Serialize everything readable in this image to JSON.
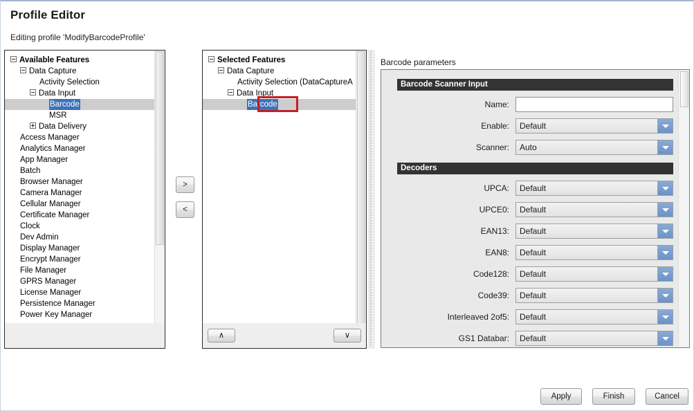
{
  "window": {
    "title": "Profile Editor",
    "subtitle": "Editing profile 'ModifyBarcodeProfile'"
  },
  "available_panel": {
    "title": "Available Features",
    "items": [
      {
        "label": "Available Features",
        "indent": 0,
        "toggle": "minus",
        "bold": true,
        "selected": false
      },
      {
        "label": "Data Capture",
        "indent": 1,
        "toggle": "minus",
        "bold": false,
        "selected": false
      },
      {
        "label": "Activity Selection",
        "indent": 3,
        "toggle": "none",
        "bold": false,
        "selected": false
      },
      {
        "label": "Data Input",
        "indent": 2,
        "toggle": "minus",
        "bold": false,
        "selected": false
      },
      {
        "label": "Barcode",
        "indent": 4,
        "toggle": "none",
        "bold": false,
        "selected": true
      },
      {
        "label": "MSR",
        "indent": 4,
        "toggle": "none",
        "bold": false,
        "selected": false
      },
      {
        "label": "Data Delivery",
        "indent": 2,
        "toggle": "plus",
        "bold": false,
        "selected": false
      },
      {
        "label": "Access Manager",
        "indent": 1,
        "toggle": "none",
        "bold": false,
        "selected": false
      },
      {
        "label": "Analytics Manager",
        "indent": 1,
        "toggle": "none",
        "bold": false,
        "selected": false
      },
      {
        "label": "App Manager",
        "indent": 1,
        "toggle": "none",
        "bold": false,
        "selected": false
      },
      {
        "label": "Batch",
        "indent": 1,
        "toggle": "none",
        "bold": false,
        "selected": false
      },
      {
        "label": "Browser Manager",
        "indent": 1,
        "toggle": "none",
        "bold": false,
        "selected": false
      },
      {
        "label": "Camera Manager",
        "indent": 1,
        "toggle": "none",
        "bold": false,
        "selected": false
      },
      {
        "label": "Cellular Manager",
        "indent": 1,
        "toggle": "none",
        "bold": false,
        "selected": false
      },
      {
        "label": "Certificate Manager",
        "indent": 1,
        "toggle": "none",
        "bold": false,
        "selected": false
      },
      {
        "label": "Clock",
        "indent": 1,
        "toggle": "none",
        "bold": false,
        "selected": false
      },
      {
        "label": "Dev Admin",
        "indent": 1,
        "toggle": "none",
        "bold": false,
        "selected": false
      },
      {
        "label": "Display Manager",
        "indent": 1,
        "toggle": "none",
        "bold": false,
        "selected": false
      },
      {
        "label": "Encrypt Manager",
        "indent": 1,
        "toggle": "none",
        "bold": false,
        "selected": false
      },
      {
        "label": "File Manager",
        "indent": 1,
        "toggle": "none",
        "bold": false,
        "selected": false
      },
      {
        "label": "GPRS Manager",
        "indent": 1,
        "toggle": "none",
        "bold": false,
        "selected": false
      },
      {
        "label": "License Manager",
        "indent": 1,
        "toggle": "none",
        "bold": false,
        "selected": false
      },
      {
        "label": "Persistence Manager",
        "indent": 1,
        "toggle": "none",
        "bold": false,
        "selected": false
      },
      {
        "label": "Power Key Manager",
        "indent": 1,
        "toggle": "none",
        "bold": false,
        "selected": false
      }
    ]
  },
  "selected_panel": {
    "title": "Selected Features",
    "items": [
      {
        "label": "Selected Features",
        "indent": 0,
        "toggle": "minus",
        "bold": true,
        "selected": false
      },
      {
        "label": "Data Capture",
        "indent": 1,
        "toggle": "minus",
        "bold": false,
        "selected": false
      },
      {
        "label": "Activity Selection (DataCaptureA",
        "indent": 3,
        "toggle": "none",
        "bold": false,
        "selected": false
      },
      {
        "label": "Data Input",
        "indent": 2,
        "toggle": "minus",
        "bold": false,
        "selected": false
      },
      {
        "label": "Barcode",
        "indent": 4,
        "toggle": "none",
        "bold": false,
        "selected": true
      }
    ]
  },
  "transfer_buttons": {
    "add_label": ">",
    "remove_label": "<"
  },
  "order_buttons": {
    "up_label": "∧",
    "down_label": "∨"
  },
  "params": {
    "caption": "Barcode parameters",
    "sections": [
      {
        "heading": "Barcode Scanner Input",
        "fields": [
          {
            "label": "Name:",
            "type": "text",
            "value": "",
            "placeholder": ""
          },
          {
            "label": "Enable:",
            "type": "combo",
            "value": "Default"
          },
          {
            "label": "Scanner:",
            "type": "combo",
            "value": "Auto"
          }
        ]
      },
      {
        "heading": "Decoders",
        "fields": [
          {
            "label": "UPCA:",
            "type": "combo",
            "value": "Default"
          },
          {
            "label": "UPCE0:",
            "type": "combo",
            "value": "Default"
          },
          {
            "label": "EAN13:",
            "type": "combo",
            "value": "Default"
          },
          {
            "label": "EAN8:",
            "type": "combo",
            "value": "Default"
          },
          {
            "label": "Code128:",
            "type": "combo",
            "value": "Default"
          },
          {
            "label": "Code39:",
            "type": "combo",
            "value": "Default"
          },
          {
            "label": "Interleaved 2of5:",
            "type": "combo",
            "value": "Default"
          },
          {
            "label": "GS1 Databar:",
            "type": "combo",
            "value": "Default"
          },
          {
            "label": "",
            "type": "combo",
            "value": ""
          }
        ]
      }
    ]
  },
  "footer_buttons": {
    "apply": "Apply",
    "finish": "Finish",
    "cancel": "Cancel"
  },
  "annotation": {
    "color": "#c0202a",
    "target": "Barcode"
  }
}
